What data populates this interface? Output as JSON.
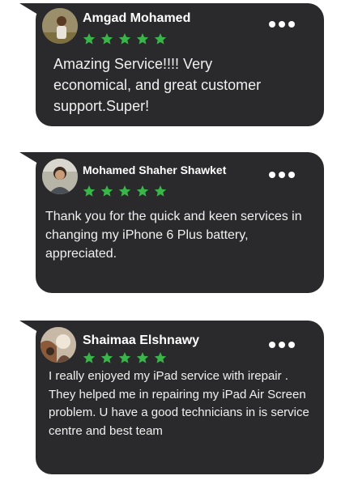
{
  "reviews": [
    {
      "name": "Amgad Mohamed",
      "rating": 5,
      "text": "Amazing Service!!!! Very economical, and great customer support.Super!",
      "menu_icon": "more-dots-icon",
      "star_color": "#3ab54a"
    },
    {
      "name": "Mohamed Shaher Shawket",
      "rating": 5,
      "text": "Thank you for the quick and keen services in changing my iPhone 6 Plus battery, appreciated.",
      "menu_icon": "more-dots-icon",
      "star_color": "#3ab54a"
    },
    {
      "name": "Shaimaa Elshnawy",
      "rating": 5,
      "text": "I really enjoyed my iPad service with irepair . They helped me in repairing my iPad Air Screen problem. U have a good technicians in is service centre and best team",
      "menu_icon": "more-dots-icon",
      "star_color": "#3ab54a"
    }
  ],
  "theme": {
    "card_background": "#2a2a2c",
    "text_color": "#f0f0f0",
    "page_background": "#ffffff"
  }
}
